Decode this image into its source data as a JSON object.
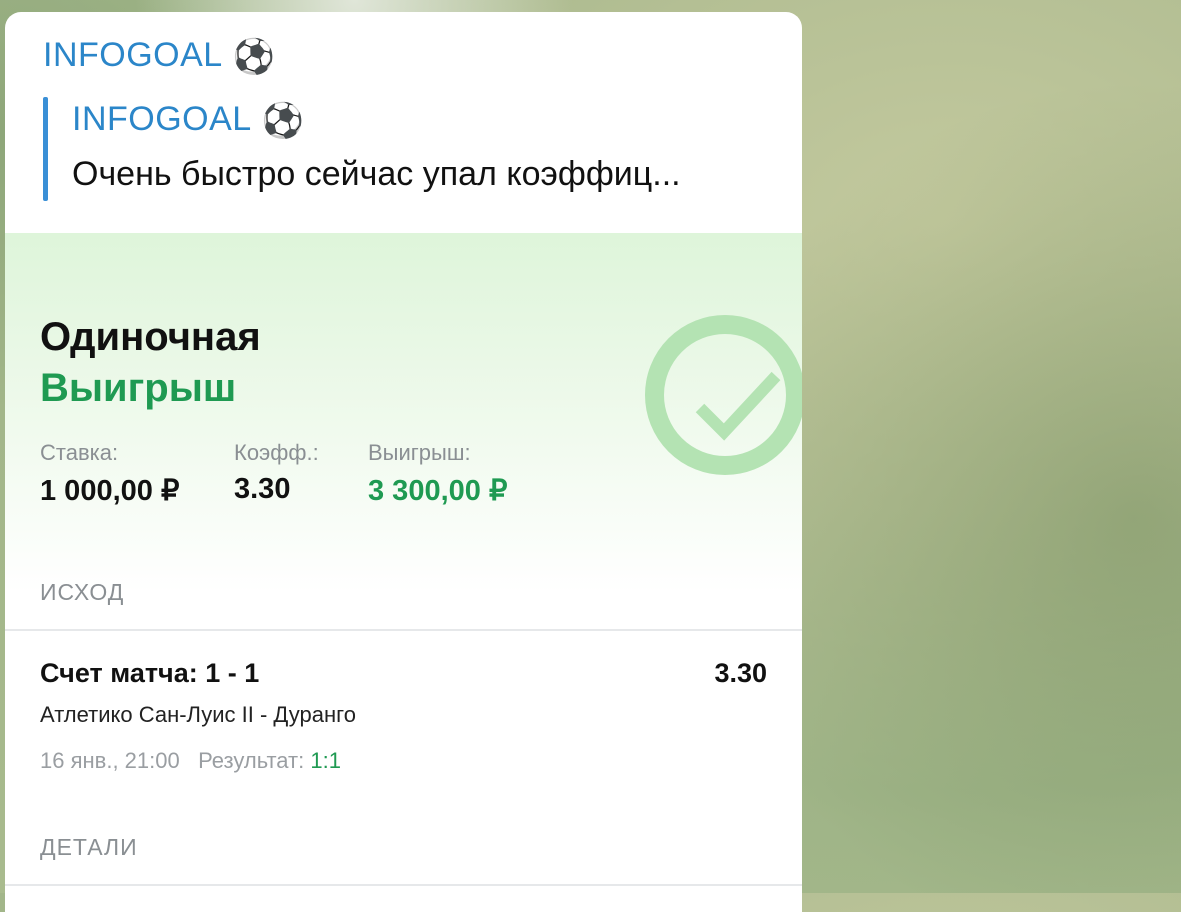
{
  "message": {
    "sender": "INFOGOAL",
    "sender_emoji": "⚽",
    "reply": {
      "name": "INFOGOAL",
      "name_emoji": "⚽",
      "text": "Очень быстро сейчас упал коэффиц..."
    }
  },
  "bet": {
    "type": "Одиночная",
    "status": "Выигрыш",
    "stake_label": "Ставка:",
    "stake_value": "1 000,00 ₽",
    "odds_label": "Коэфф.:",
    "odds_value": "3.30",
    "win_label": "Выигрыш:",
    "win_value": "3 300,00 ₽",
    "status_icon": "check-circle-icon"
  },
  "outcome": {
    "section_title": "ИСХОД",
    "title": "Счет матча: 1 - 1",
    "odds": "3.30",
    "match": "Атлетико Сан-Луис II - Дуранго",
    "datetime": "16 янв., 21:00",
    "result_label": "Результат:",
    "result_value": "1:1"
  },
  "details": {
    "section_title": "ДЕТАЛИ"
  },
  "colors": {
    "accent_blue": "#2b86c9",
    "win_green": "#1f9a52"
  }
}
